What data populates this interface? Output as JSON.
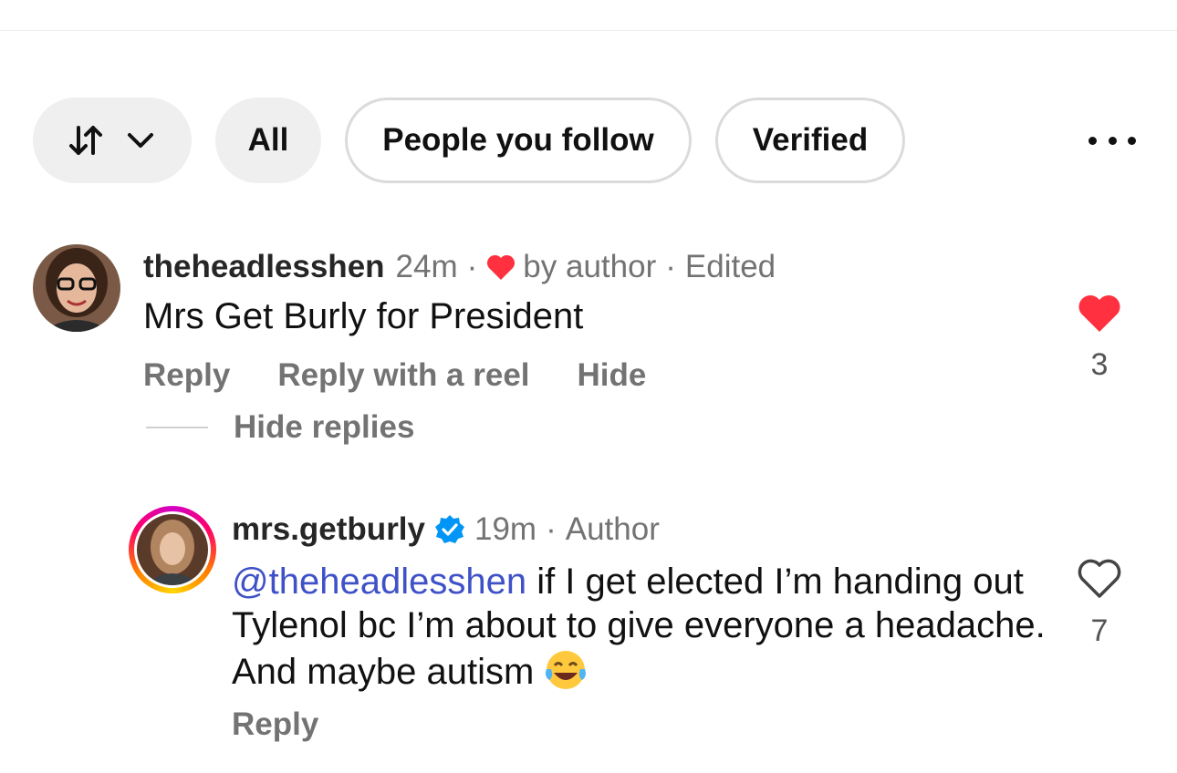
{
  "filters": {
    "sort_label": "",
    "all_label": "All",
    "follow_label": "People you follow",
    "verified_label": "Verified"
  },
  "comments": [
    {
      "username": "theheadlesshen",
      "time": "24m",
      "liked_by_author_label": "by author",
      "edited_label": "Edited",
      "text": "Mrs Get Burly for President",
      "actions": [
        "Reply",
        "Reply with a reel",
        "Hide"
      ],
      "like_count": "3",
      "liked": true,
      "hide_replies_label": "Hide replies"
    },
    {
      "username": "mrs.getburly",
      "verified": true,
      "time": "19m",
      "role_label": "Author",
      "mention": "@theheadlesshen",
      "text": " if I get elected I’m handing out Tylenol bc I’m about to give everyone a headache. And maybe autism",
      "emoji_name": "face-with-tears-of-joy",
      "actions": [
        "Reply"
      ],
      "like_count": "7",
      "liked": false
    }
  ],
  "colors": {
    "heart_red": "#ff3040",
    "mention_blue": "#3f51c7",
    "verified_blue": "#0095f6"
  }
}
